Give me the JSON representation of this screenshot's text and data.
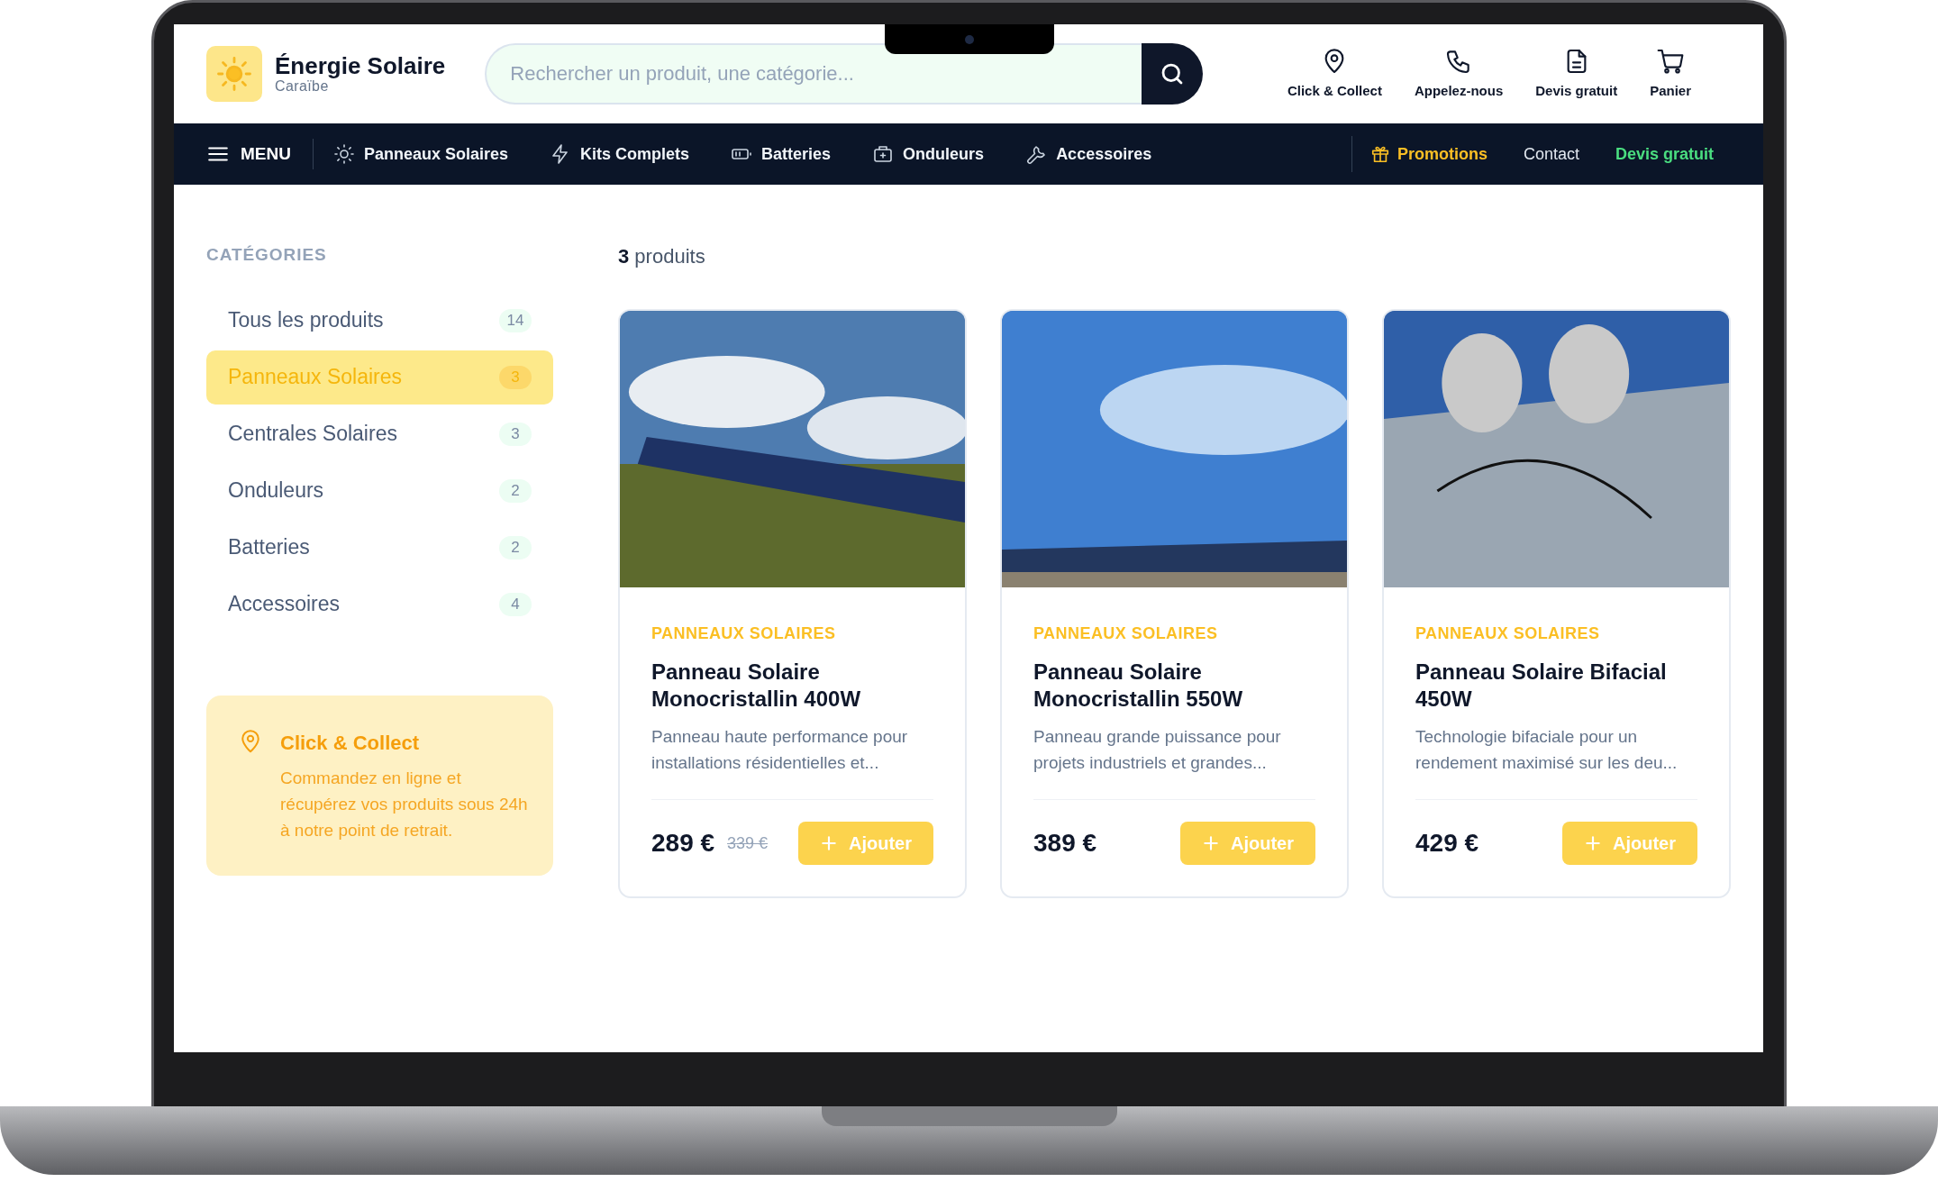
{
  "header": {
    "brand": "Énergie Solaire",
    "brand_subtitle": "Caraïbe",
    "search": {
      "placeholder": "Rechercher un produit, une catégorie..."
    },
    "actions": [
      {
        "label": "Click & Collect"
      },
      {
        "label": "Appelez-nous"
      },
      {
        "label": "Devis gratuit"
      },
      {
        "label": "Panier"
      }
    ]
  },
  "nav": {
    "menu": "MENU",
    "items": [
      {
        "label": "Panneaux Solaires"
      },
      {
        "label": "Kits Complets"
      },
      {
        "label": "Batteries"
      },
      {
        "label": "Onduleurs"
      },
      {
        "label": "Accessoires"
      }
    ],
    "links": [
      {
        "label": "Promotions",
        "kind": "promo"
      },
      {
        "label": "Contact",
        "kind": "plain"
      },
      {
        "label": "Devis gratuit",
        "kind": "highlight"
      }
    ]
  },
  "sidebar": {
    "title": "CATÉGORIES",
    "categories": [
      {
        "label": "Tous les produits",
        "count": "14",
        "selected": false
      },
      {
        "label": "Panneaux Solaires",
        "count": "3",
        "selected": true
      },
      {
        "label": "Centrales Solaires",
        "count": "3",
        "selected": false
      },
      {
        "label": "Onduleurs",
        "count": "2",
        "selected": false
      },
      {
        "label": "Batteries",
        "count": "2",
        "selected": false
      },
      {
        "label": "Accessoires",
        "count": "4",
        "selected": false
      }
    ],
    "info_card": {
      "title": "Click & Collect",
      "text": "Commandez en ligne et récupérez vos produits sous 24h à notre point de retrait."
    }
  },
  "results": "**3** produits",
  "products": [
    {
      "category": "PANNEAUX SOLAIRES",
      "title": "Panneau Solaire Monocristallin 400W",
      "description": "Panneau haute performance pour installations résidentielles et...",
      "price": "289 €",
      "old_price": "339 €",
      "button": "Ajouter"
    },
    {
      "category": "PANNEAUX SOLAIRES",
      "title": "Panneau Solaire Monocristallin 550W",
      "description": "Panneau grande puissance pour projets industriels et grandes...",
      "price": "389 €",
      "button": "Ajouter"
    },
    {
      "category": "PANNEAUX SOLAIRES",
      "title": "Panneau Solaire Bifacial 450W",
      "description": "Technologie bifaciale pour un rendement maximisé sur les deu...",
      "price": "429 €",
      "button": "Ajouter"
    }
  ]
}
